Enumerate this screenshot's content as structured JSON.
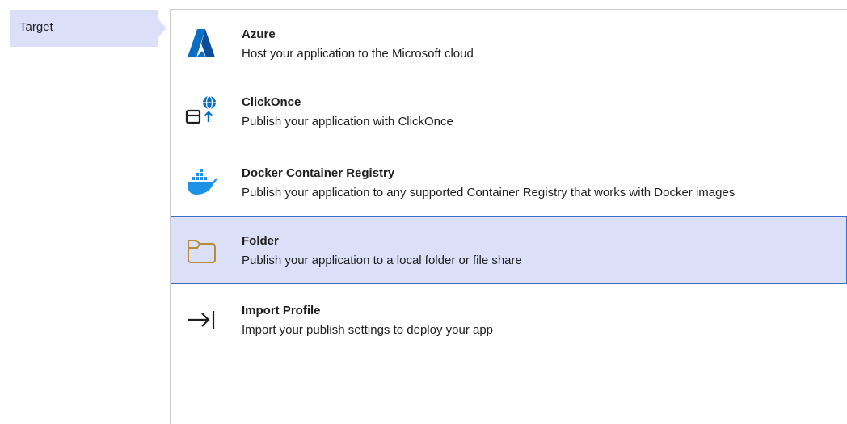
{
  "wizard": {
    "steps": [
      {
        "label": "Target",
        "selected": true
      }
    ]
  },
  "targets": [
    {
      "title": "Azure",
      "description": "Host your application to the Microsoft cloud",
      "icon": "azure-icon",
      "selected": false
    },
    {
      "title": "ClickOnce",
      "description": "Publish your application with ClickOnce",
      "icon": "clickonce-icon",
      "selected": false
    },
    {
      "title": "Docker Container Registry",
      "description": "Publish your application to any supported Container Registry that works with Docker images",
      "icon": "docker-icon",
      "selected": false
    },
    {
      "title": "Folder",
      "description": "Publish your application to a local folder or file share",
      "icon": "folder-icon",
      "selected": true
    },
    {
      "title": "Import Profile",
      "description": "Import your publish settings to deploy your app",
      "icon": "import-icon",
      "selected": false
    }
  ],
  "colors": {
    "selection_bg": "#dcdff8",
    "selection_border": "#3c6fc4",
    "azure_blue": "#0a6fc2",
    "docker_blue": "#1d91e6",
    "folder_brown": "#b88a3a"
  }
}
